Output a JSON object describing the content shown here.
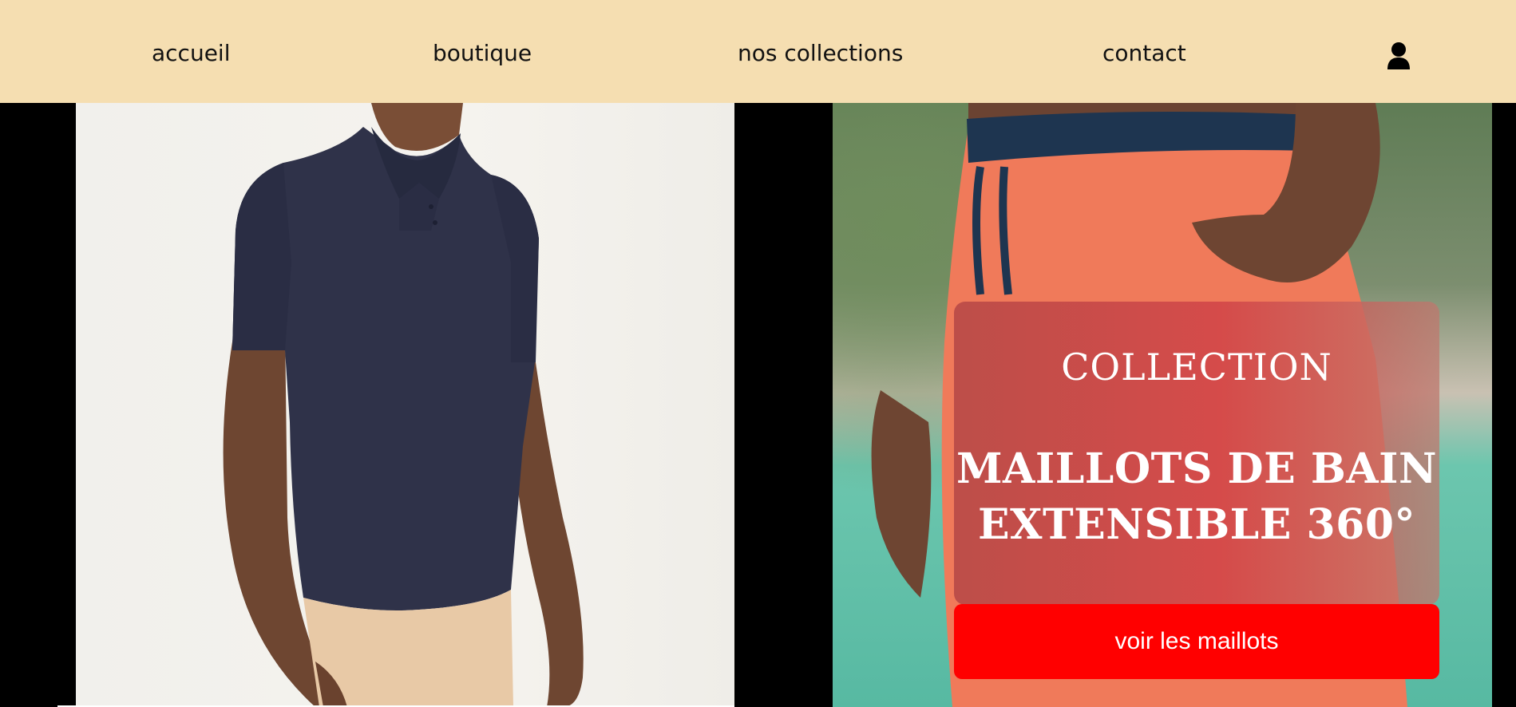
{
  "nav": {
    "items": [
      {
        "label": "accueil"
      },
      {
        "label": "boutique"
      },
      {
        "label": "nos collections"
      },
      {
        "label": "contact"
      }
    ],
    "user_icon": "user-icon"
  },
  "hero": {
    "left_image": "man-in-navy-polo-shirt-photo",
    "right_image": "coral-swim-shorts-photo",
    "promo": {
      "eyebrow": "COLLECTION",
      "title_line1": "MAILLOTS DE BAIN",
      "title_line2": "EXTENSIBLE 360°",
      "cta_label": "voir les maillots"
    }
  },
  "colors": {
    "nav_background": "#f5deb1",
    "cta_background": "#ff0000",
    "page_background": "#000000"
  }
}
